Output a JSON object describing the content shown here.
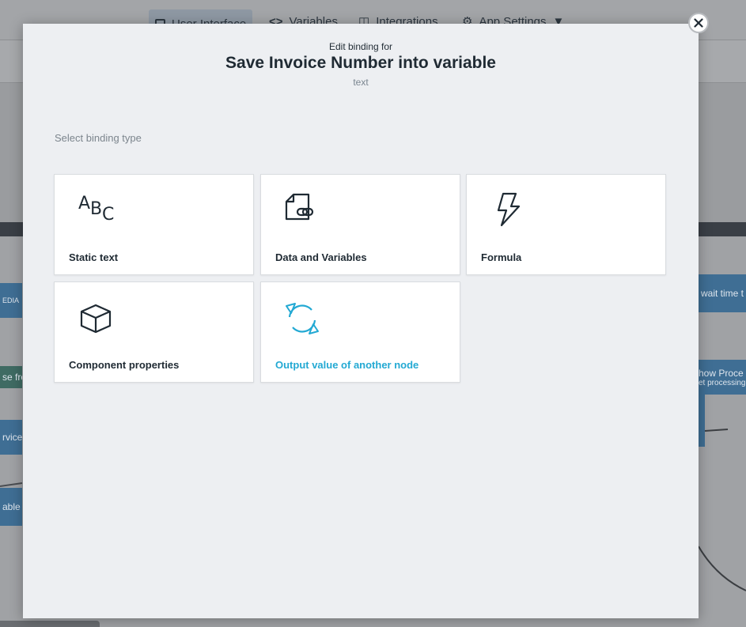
{
  "background": {
    "tabs": [
      {
        "label": "User Interface",
        "icon": "page-icon",
        "active": true
      },
      {
        "label": "Variables",
        "icon": "code-brackets-icon",
        "active": false
      },
      {
        "label": "Integrations",
        "icon": "database-icon",
        "active": false
      },
      {
        "label": "App Settings",
        "icon": "gear-icon",
        "active": false
      }
    ],
    "nodes": {
      "media": "EDIA",
      "response": "se fro",
      "service": "rvice",
      "variable": "able",
      "wait": "wait time t",
      "process_title": "how Proce",
      "process_sub": "et processing"
    }
  },
  "modal": {
    "pretitle": "Edit binding for",
    "title": "Save Invoice Number into variable",
    "subtitle": "text",
    "section_label": "Select binding type",
    "options": [
      {
        "label": "Static text",
        "icon": "abc-text-icon",
        "selected": false
      },
      {
        "label": "Data and Variables",
        "icon": "document-link-icon",
        "selected": false
      },
      {
        "label": "Formula",
        "icon": "lightning-bolt-icon",
        "selected": false
      },
      {
        "label": "Component properties",
        "icon": "cube-icon",
        "selected": false
      },
      {
        "label": "Output value of another node",
        "icon": "refresh-cycle-icon",
        "selected": true
      }
    ],
    "static_icon_glyphs": {
      "a": "A",
      "b": "B",
      "c": "C"
    }
  },
  "colors": {
    "accent": "#23a9d3",
    "text": "#1f2a33",
    "muted": "#7c858d",
    "modal_bg": "#edeff2"
  }
}
